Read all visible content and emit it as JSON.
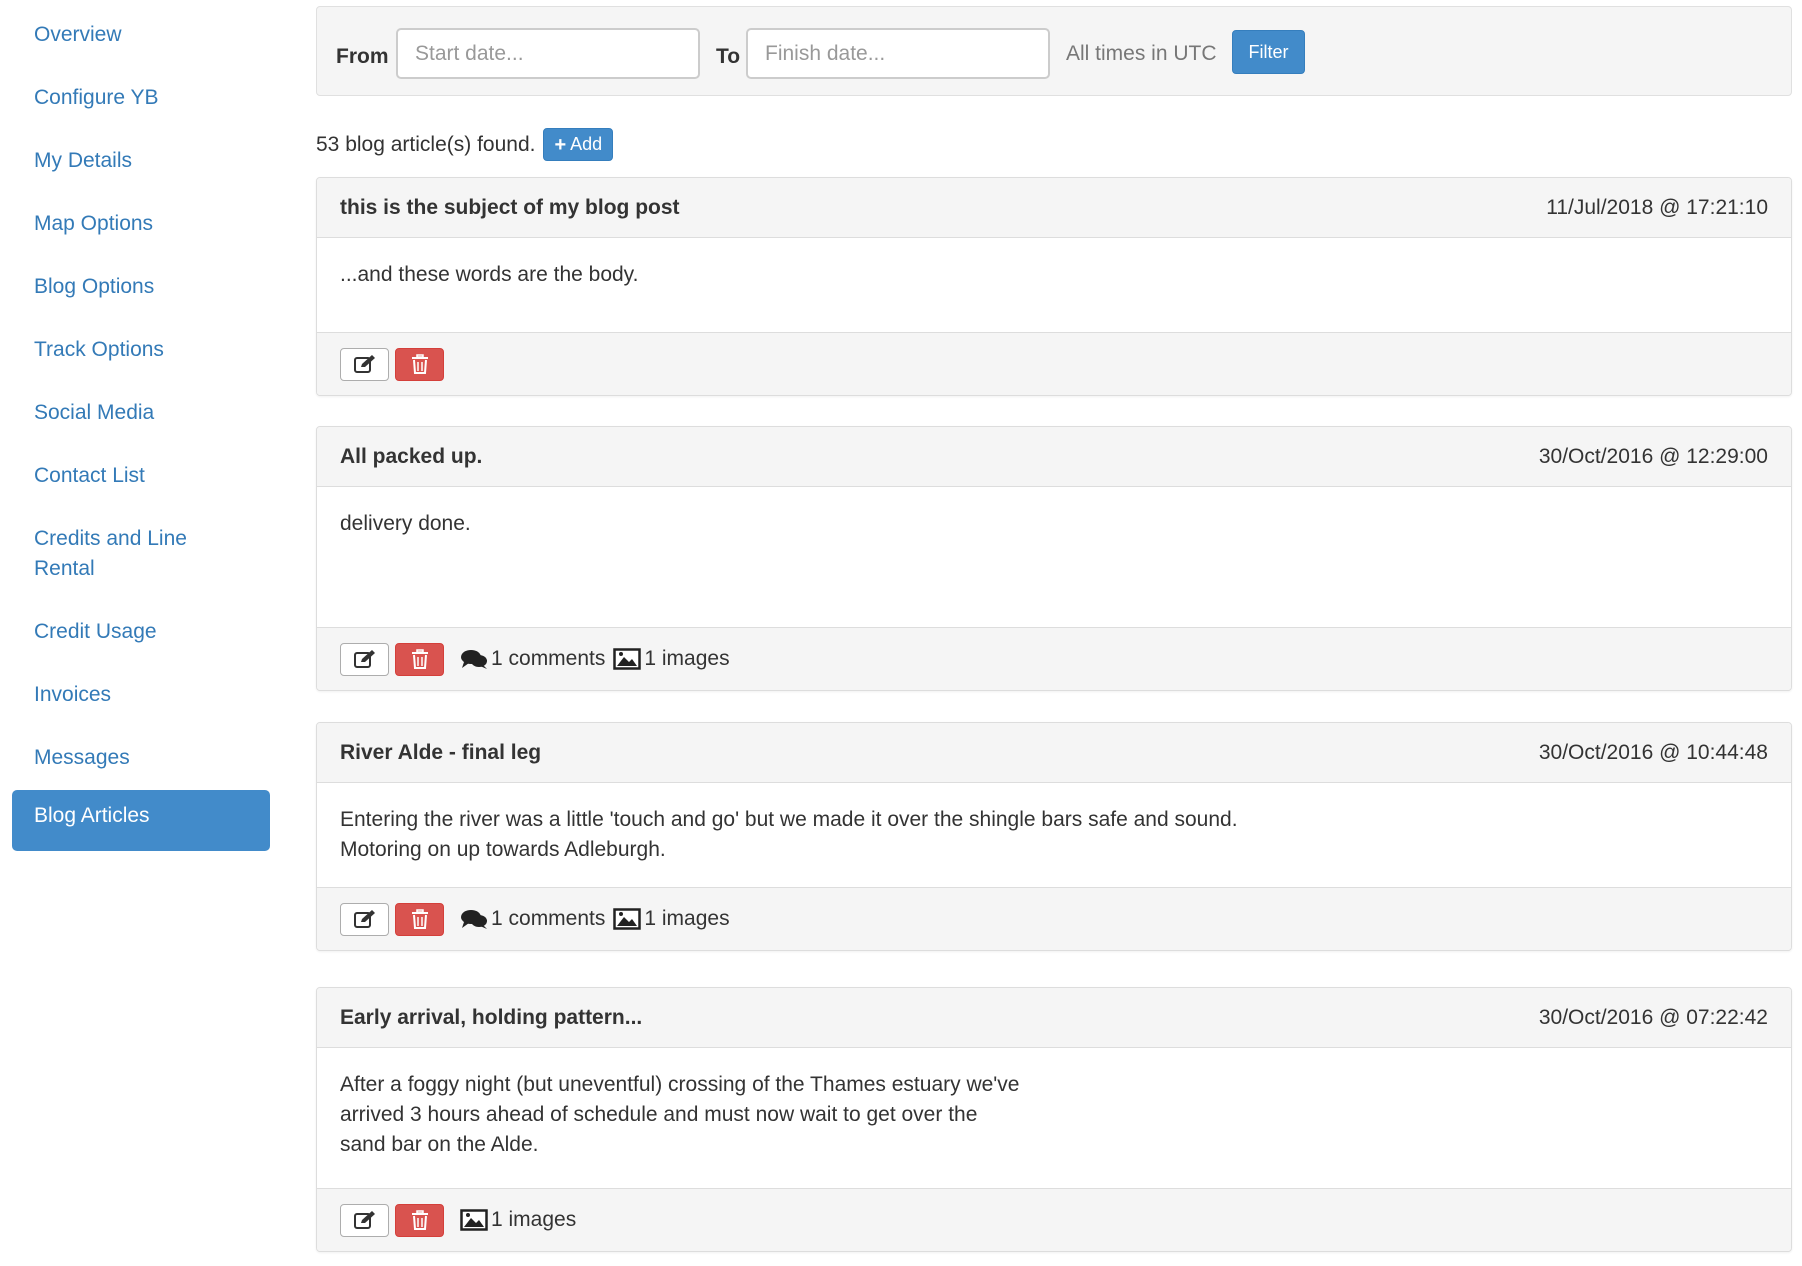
{
  "sidebar": {
    "items": [
      {
        "label": "Overview"
      },
      {
        "label": "Configure YB"
      },
      {
        "label": "My Details"
      },
      {
        "label": "Map Options"
      },
      {
        "label": "Blog Options"
      },
      {
        "label": "Track Options"
      },
      {
        "label": "Social Media"
      },
      {
        "label": "Contact List"
      },
      {
        "label": "Credits and Line\nRental"
      },
      {
        "label": "Credit Usage"
      },
      {
        "label": "Invoices"
      },
      {
        "label": "Messages"
      },
      {
        "label": "Blog Articles",
        "active": true
      }
    ]
  },
  "filter": {
    "from_label": "From",
    "from_placeholder": "Start date...",
    "to_label": "To",
    "to_placeholder": "Finish date...",
    "timezone_note": "All times in UTC",
    "button_label": "Filter"
  },
  "results": {
    "count_text": "53 blog article(s) found.",
    "add_label": "Add"
  },
  "articles": [
    {
      "title": "this is the subject of my blog post",
      "date": "11/Jul/2018 @ 17:21:10",
      "body": "...and these words are the body.",
      "comments": "",
      "images": ""
    },
    {
      "title": "All packed up.",
      "date": "30/Oct/2016 @ 12:29:00",
      "body": "delivery done.",
      "comments": "1 comments",
      "images": "1 images"
    },
    {
      "title": "River Alde - final leg",
      "date": "30/Oct/2016 @ 10:44:48",
      "body": "Entering the river was a little 'touch and go' but we made it over the shingle bars safe and sound.\nMotoring on up towards Adleburgh.",
      "comments": "1 comments",
      "images": "1 images"
    },
    {
      "title": "Early arrival, holding pattern...",
      "date": "30/Oct/2016 @ 07:22:42",
      "body": "After a foggy night (but uneventful) crossing of the Thames estuary we've\narrived 3 hours ahead of schedule and must now wait to get over the\nsand bar on the Alde.",
      "comments": "",
      "images": "1 images"
    }
  ],
  "icons": {
    "edit": "pencil-square-icon",
    "delete": "trash-icon",
    "comments": "comments-icon",
    "images": "picture-icon",
    "add": "plus-icon"
  },
  "colors": {
    "link": "#337ab7",
    "primary": "#428bca",
    "danger": "#d9534f",
    "panel_bg": "#f5f5f5"
  }
}
